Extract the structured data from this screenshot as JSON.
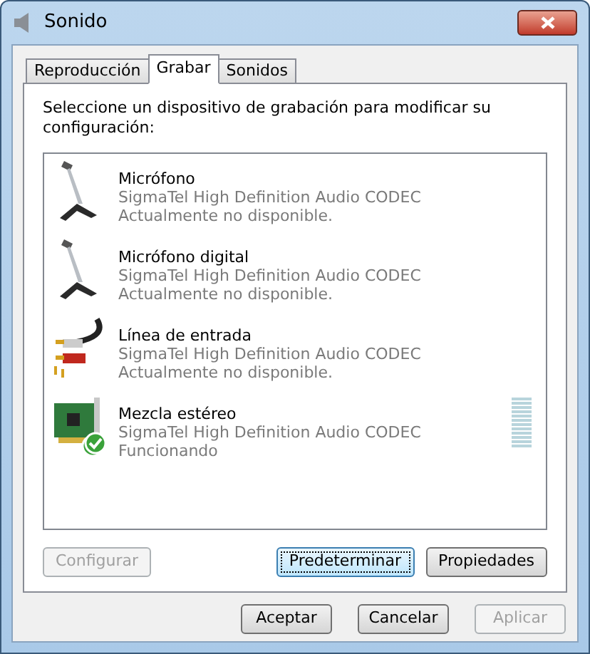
{
  "window": {
    "title": "Sonido"
  },
  "tabs": [
    {
      "label": "Reproducción",
      "selected": false
    },
    {
      "label": "Grabar",
      "selected": true
    },
    {
      "label": "Sonidos",
      "selected": false
    }
  ],
  "instructions": "Seleccione un dispositivo de grabación para modificar su configuración:",
  "devices": [
    {
      "kind": "microphone",
      "name": "Micrófono",
      "driver": "SigmaTel High Definition Audio CODEC",
      "status": "Actualmente no disponible.",
      "default": false
    },
    {
      "kind": "microphone",
      "name": "Micrófono digital",
      "driver": "SigmaTel High Definition Audio CODEC",
      "status": "Actualmente no disponible.",
      "default": false
    },
    {
      "kind": "cable",
      "name": "Línea de entrada",
      "driver": "SigmaTel High Definition Audio CODEC",
      "status": "Actualmente no disponible.",
      "default": false
    },
    {
      "kind": "card",
      "name": "Mezcla estéreo",
      "driver": "SigmaTel High Definition Audio CODEC",
      "status": "Funcionando",
      "default": true,
      "meter": {
        "level": 0
      }
    }
  ],
  "panel_buttons": [
    {
      "label": "Configurar",
      "disabled": true,
      "focused": false
    },
    {
      "label": "Predeterminar",
      "disabled": false,
      "focused": true
    },
    {
      "label": "Propiedades",
      "disabled": false,
      "focused": false
    }
  ],
  "dialog_buttons": [
    {
      "label": "Aceptar",
      "disabled": false
    },
    {
      "label": "Cancelar",
      "disabled": false
    },
    {
      "label": "Aplicar",
      "disabled": true
    }
  ]
}
